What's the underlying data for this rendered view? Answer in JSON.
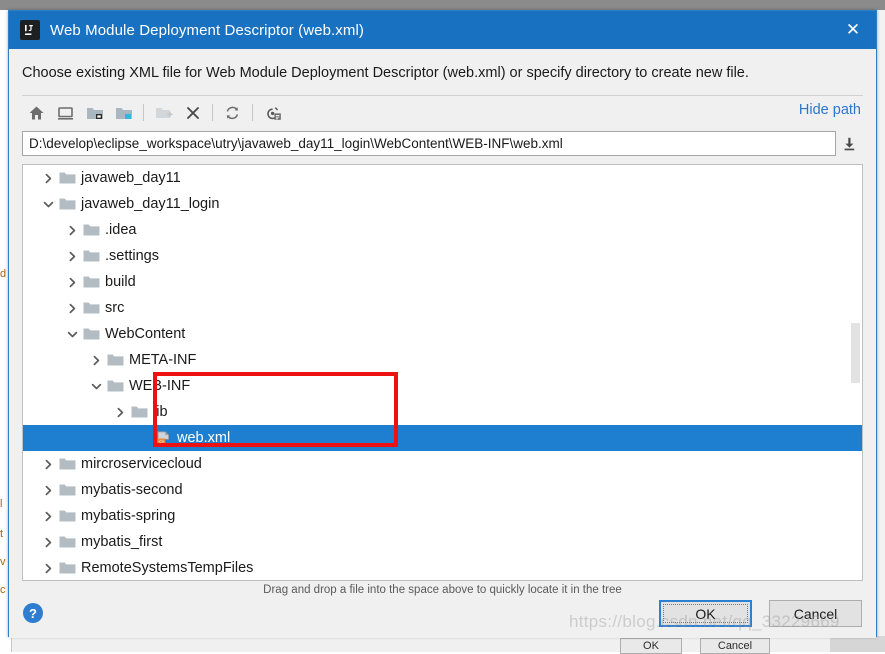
{
  "window": {
    "title": "Web Module Deployment Descriptor (web.xml)",
    "app_icon": "intellij-idea-logo",
    "close_label": "✕",
    "titlebar_color": "#1971c2"
  },
  "dialog": {
    "prompt": "Choose existing XML file for Web Module Deployment Descriptor (web.xml) or specify directory to create new file.",
    "hint": "Drag and drop a file into the space above to quickly locate it in the tree",
    "hide_path_label": "Hide path",
    "help_label": "?",
    "ok_label": "OK",
    "cancel_label": "Cancel"
  },
  "toolbar": {
    "buttons": [
      {
        "name": "home-icon",
        "tooltip": "Home"
      },
      {
        "name": "desktop-icon",
        "tooltip": "Desktop"
      },
      {
        "name": "project-folder-icon",
        "tooltip": "Project"
      },
      {
        "name": "module-folder-icon",
        "tooltip": "Module"
      },
      {
        "name": "new-folder-icon",
        "tooltip": "New Folder",
        "disabled": true
      },
      {
        "name": "delete-icon",
        "tooltip": "Delete"
      },
      {
        "name": "refresh-icon",
        "tooltip": "Refresh"
      },
      {
        "name": "show-hidden-files-icon",
        "tooltip": "Show Hidden Files and Directories"
      }
    ]
  },
  "path_field": {
    "value": "D:\\develop\\eclipse_workspace\\utry\\javaweb_day11_login\\WebContent\\WEB-INF\\web.xml",
    "placeholder": "",
    "drop_icon": "drop-down-history-icon"
  },
  "tree": {
    "rows": [
      {
        "label": "javaweb_day11",
        "indent": 0,
        "twisty": "collapsed",
        "icon": "folder-icon",
        "selected": false
      },
      {
        "label": "javaweb_day11_login",
        "indent": 0,
        "twisty": "expanded",
        "icon": "folder-icon",
        "selected": false
      },
      {
        "label": ".idea",
        "indent": 1,
        "twisty": "collapsed",
        "icon": "folder-icon",
        "selected": false
      },
      {
        "label": ".settings",
        "indent": 1,
        "twisty": "collapsed",
        "icon": "folder-icon",
        "selected": false
      },
      {
        "label": "build",
        "indent": 1,
        "twisty": "collapsed",
        "icon": "folder-icon",
        "selected": false
      },
      {
        "label": "src",
        "indent": 1,
        "twisty": "collapsed",
        "icon": "folder-icon",
        "selected": false
      },
      {
        "label": "WebContent",
        "indent": 1,
        "twisty": "expanded",
        "icon": "folder-icon",
        "selected": false
      },
      {
        "label": "META-INF",
        "indent": 2,
        "twisty": "collapsed",
        "icon": "folder-icon",
        "selected": false
      },
      {
        "label": "WEB-INF",
        "indent": 2,
        "twisty": "expanded",
        "icon": "folder-icon",
        "selected": false
      },
      {
        "label": "lib",
        "indent": 3,
        "twisty": "collapsed",
        "icon": "folder-icon",
        "selected": false
      },
      {
        "label": "web.xml",
        "indent": 4,
        "twisty": "none",
        "icon": "xml-file-icon",
        "selected": true
      },
      {
        "label": "mircroservicecloud",
        "indent": 0,
        "twisty": "collapsed",
        "icon": "folder-icon",
        "selected": false
      },
      {
        "label": "mybatis-second",
        "indent": 0,
        "twisty": "collapsed",
        "icon": "folder-icon",
        "selected": false
      },
      {
        "label": "mybatis-spring",
        "indent": 0,
        "twisty": "collapsed",
        "icon": "folder-icon",
        "selected": false
      },
      {
        "label": "mybatis_first",
        "indent": 0,
        "twisty": "collapsed",
        "icon": "folder-icon",
        "selected": false
      },
      {
        "label": "RemoteSystemsTempFiles",
        "indent": 0,
        "twisty": "collapsed",
        "icon": "folder-icon",
        "selected": false
      }
    ],
    "annotation": {
      "name": "red-highlight-box",
      "color": "#ee1111"
    },
    "selection_color": "#1e7fd0"
  },
  "watermark": {
    "text": "https://blog.csdn.net/qq_33229669"
  },
  "background": {
    "ok_label": "OK",
    "cancel_label": "Cancel",
    "left_fragments": [
      "d",
      "l",
      "t",
      "v",
      "c"
    ]
  }
}
